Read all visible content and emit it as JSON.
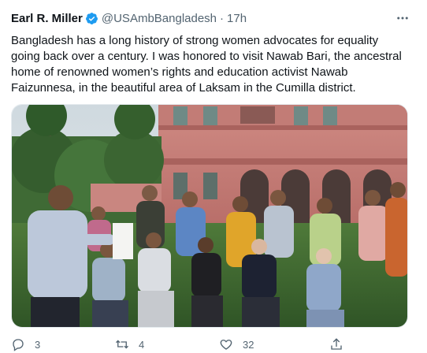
{
  "tweet": {
    "display_name": "Earl R. Miller",
    "handle": "@USAmbBangladesh",
    "separator": "·",
    "timestamp": "17h",
    "text": "Bangladesh has a long history of strong women advocates for equality going back over a century. I was honored to visit Nawab Bari, the ancestral home of renowned women’s rights and education activist Nawab Faizunnesa, in the beautiful area of Laksam in the Cumilla district.",
    "image": "group-photo"
  },
  "actions": {
    "reply_count": "3",
    "retweet_count": "4",
    "like_count": "32"
  },
  "icons": {
    "verified": "verified-badge-icon",
    "more": "more-options-icon",
    "reply": "reply-icon",
    "retweet": "retweet-icon",
    "like": "heart-icon",
    "share": "share-icon"
  },
  "colors": {
    "verified": "#1d9bf0",
    "secondary_text": "#536471",
    "primary_text": "#0f1419"
  }
}
